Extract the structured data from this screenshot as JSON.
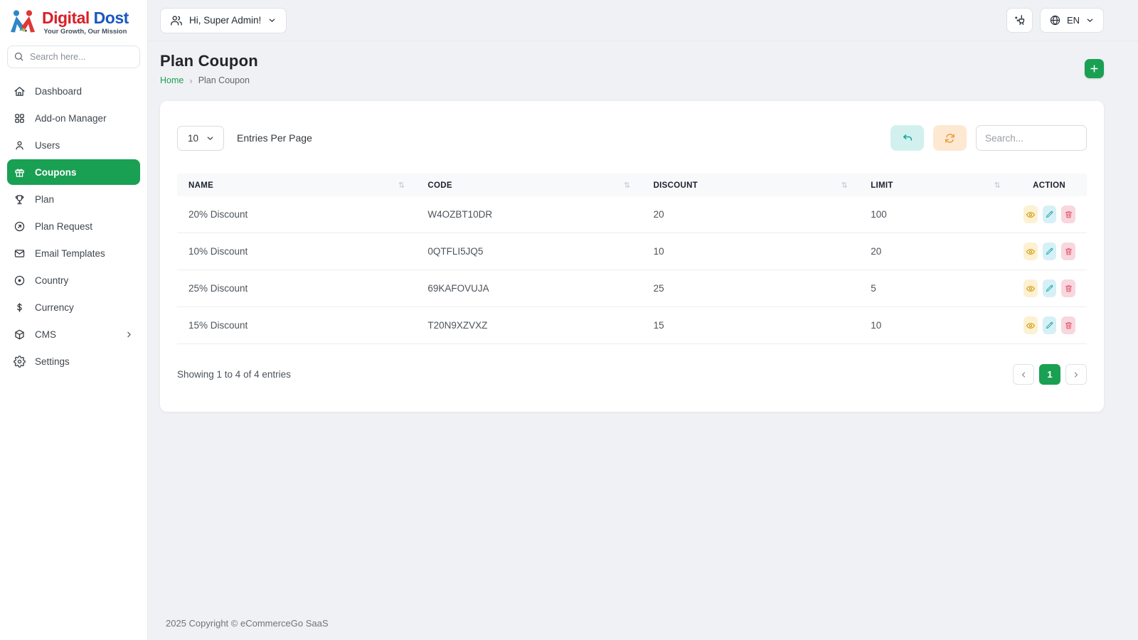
{
  "brand": {
    "title_primary": "Digital",
    "title_secondary": "Dost",
    "tagline": "Your Growth, Our Mission",
    "logo_icon": "people-logo"
  },
  "topbar": {
    "user_menu": {
      "label": "Hi, Super Admin!",
      "icon": "users-icon",
      "chevron": "chevron-down-icon"
    },
    "clear_icon": "broom-icon",
    "language": {
      "code": "EN",
      "icon": "globe-icon",
      "chevron": "chevron-down-icon"
    }
  },
  "sidebar": {
    "search_placeholder": "Search here...",
    "search_icon": "search-icon",
    "items": [
      {
        "label": "Dashboard",
        "icon": "home-icon",
        "active": false
      },
      {
        "label": "Add-on Manager",
        "icon": "grid-icon",
        "active": false
      },
      {
        "label": "Users",
        "icon": "user-icon",
        "active": false
      },
      {
        "label": "Coupons",
        "icon": "gift-icon",
        "active": true
      },
      {
        "label": "Plan",
        "icon": "trophy-icon",
        "active": false
      },
      {
        "label": "Plan Request",
        "icon": "arrow-up-right-circle-icon",
        "active": false
      },
      {
        "label": "Email Templates",
        "icon": "mail-icon",
        "active": false
      },
      {
        "label": "Country",
        "icon": "target-icon",
        "active": false
      },
      {
        "label": "Currency",
        "icon": "dollar-icon",
        "active": false
      },
      {
        "label": "CMS",
        "icon": "package-icon",
        "active": false,
        "has_submenu": true
      },
      {
        "label": "Settings",
        "icon": "gear-icon",
        "active": false
      }
    ]
  },
  "page": {
    "title": "Plan Coupon",
    "breadcrumb": [
      "Home",
      "Plan Coupon"
    ],
    "add_button_icon": "plus-icon"
  },
  "controls": {
    "entries_value": "10",
    "entries_label": "Entries Per Page",
    "undo_icon": "undo-icon",
    "refresh_icon": "refresh-icon",
    "search_placeholder": "Search..."
  },
  "table": {
    "headers": [
      "NAME",
      "CODE",
      "DISCOUNT",
      "LIMIT",
      "ACTION"
    ],
    "rows": [
      {
        "name": "20% Discount",
        "code": "W4OZBT10DR",
        "discount": "20",
        "limit": "100"
      },
      {
        "name": "10% Discount",
        "code": "0QTFLI5JQ5",
        "discount": "10",
        "limit": "20"
      },
      {
        "name": "25% Discount",
        "code": "69KAFOVUJA",
        "discount": "25",
        "limit": "5"
      },
      {
        "name": "15% Discount",
        "code": "T20N9XZVXZ",
        "discount": "15",
        "limit": "10"
      }
    ],
    "row_actions": [
      "view",
      "edit",
      "delete"
    ],
    "summary": "Showing 1 to 4 of 4 entries"
  },
  "pagination": {
    "current_page": "1"
  },
  "footer": {
    "text": "2025 Copyright © eCommerceGo SaaS"
  },
  "colors": {
    "accent_green": "#1aa053",
    "brand_red": "#d92027",
    "brand_blue": "#1a57c2",
    "view_fg": "#d29b13",
    "edit_fg": "#27b1aa",
    "delete_fg": "#e4556e",
    "undo_fg": "#18a7a0",
    "refresh_fg": "#ef9834"
  }
}
